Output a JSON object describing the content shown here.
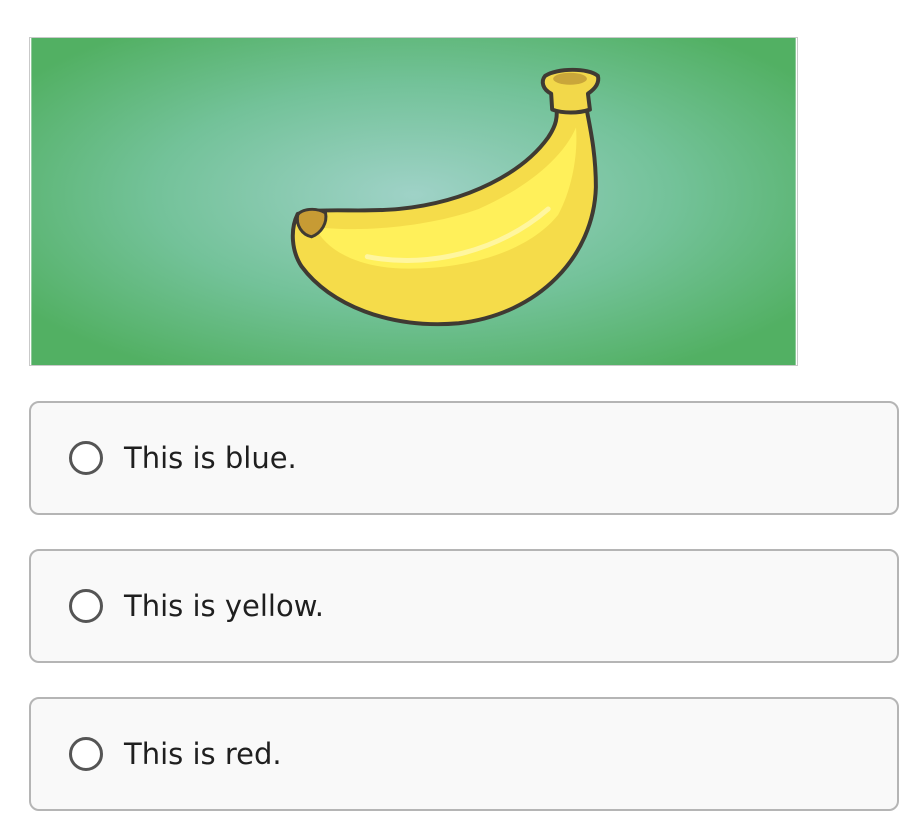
{
  "question_image": {
    "subject": "banana",
    "background_color": "#55b26b",
    "fruit_color": "#f7df42"
  },
  "options": [
    {
      "label": "This is blue.",
      "selected": false
    },
    {
      "label": "This is yellow.",
      "selected": false
    },
    {
      "label": "This is red.",
      "selected": false
    }
  ],
  "colors": {
    "option_border": "#b5b5b5",
    "option_background": "#f9f9f9",
    "radio_border": "#555555"
  }
}
